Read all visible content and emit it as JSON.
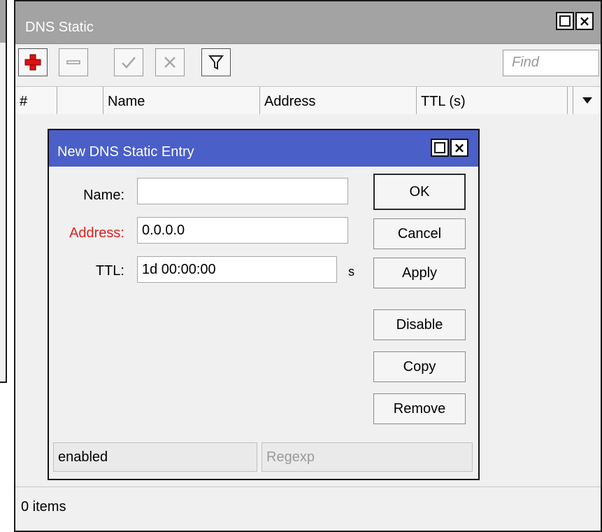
{
  "window": {
    "title": "DNS Static",
    "maximize_icon": "maximize-icon",
    "close_icon": "close-icon"
  },
  "toolbar": {
    "add_icon": "plus-icon",
    "remove_icon": "minus-icon",
    "enable_icon": "check-icon",
    "disable_icon": "cross-icon",
    "filter_icon": "funnel-icon",
    "find_placeholder": "Find"
  },
  "table": {
    "columns": [
      "#",
      "",
      "Name",
      "Address",
      "TTL (s)"
    ],
    "menu_icon": "dropdown-arrow-icon",
    "rows": []
  },
  "status": {
    "items": "0 items"
  },
  "dialog": {
    "title": "New DNS Static Entry",
    "fields": {
      "name": {
        "label": "Name:",
        "value": ""
      },
      "address": {
        "label": "Address:",
        "value": "0.0.0.0"
      },
      "ttl": {
        "label": "TTL:",
        "value": "1d 00:00:00",
        "unit": "s"
      }
    },
    "buttons": {
      "ok": "OK",
      "cancel": "Cancel",
      "apply": "Apply",
      "disable": "Disable",
      "copy": "Copy",
      "remove": "Remove"
    },
    "status": {
      "state": "enabled",
      "regexp": "Regexp"
    }
  },
  "colors": {
    "dialog_title_bg": "#4a5fc8",
    "window_title_bg": "#a3a3a3",
    "required_label": "#e02020",
    "add_icon": "#e01010"
  }
}
